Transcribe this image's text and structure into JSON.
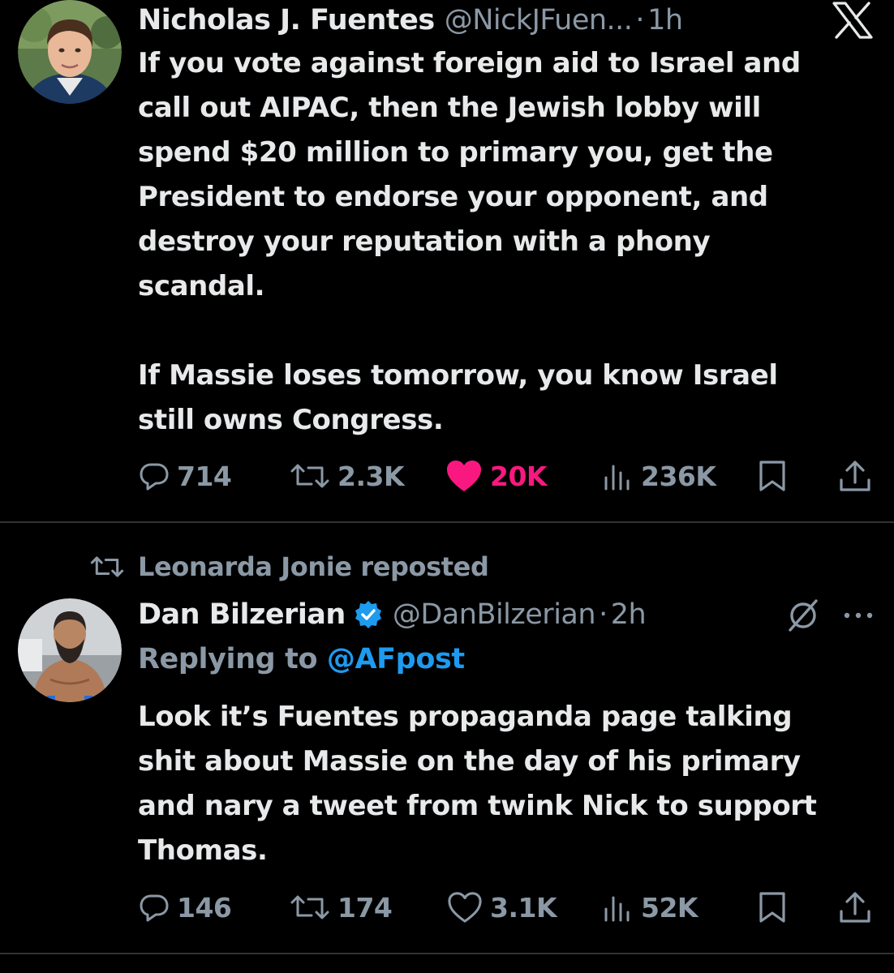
{
  "tweets": [
    {
      "author": {
        "name": "Nicholas J. Fuentes",
        "handle": "@NickJFuen...",
        "time": "1h"
      },
      "paragraphs": [
        [
          "If you vote against foreign aid to Israel and",
          "call out AIPAC, then the Jewish lobby will",
          "spend $20 million to primary you, get the",
          "President to endorse your opponent, and",
          "destroy your reputation with a phony",
          "scandal."
        ],
        [
          "If Massie loses tomorrow, you know Israel",
          "still owns Congress."
        ]
      ],
      "stats": {
        "replies": "714",
        "reposts": "2.3K",
        "likes": "20K",
        "views": "236K"
      },
      "liked": true
    },
    {
      "reposted_by": "Leonarda Jonie reposted",
      "author": {
        "name": "Dan Bilzerian",
        "handle": "@DanBilzerian",
        "time": "2h",
        "verified": true
      },
      "replying_to": {
        "prefix": "Replying to",
        "mention": "@AFpost"
      },
      "paragraphs": [
        [
          "Look it’s Fuentes propaganda page talking",
          "shit about Massie on the day of his primary",
          "and nary a tweet from twink Nick to support",
          "Thomas."
        ]
      ],
      "stats": {
        "replies": "146",
        "reposts": "174",
        "likes": "3.1K",
        "views": "52K"
      },
      "liked": false
    }
  ],
  "icons": {
    "brand": "x-logo-icon",
    "reply": "reply-icon",
    "repost": "repost-icon",
    "like": "heart-icon",
    "views": "views-icon",
    "bookmark": "bookmark-icon",
    "share": "share-icon",
    "verified": "verified-badge-icon",
    "grok": "grok-icon",
    "more": "more-icon"
  },
  "colors": {
    "background": "#000000",
    "text": "#e7e9ea",
    "secondary": "#8b98a5",
    "like": "#f91880",
    "link": "#1d9bf0",
    "divider": "#2f3336"
  }
}
